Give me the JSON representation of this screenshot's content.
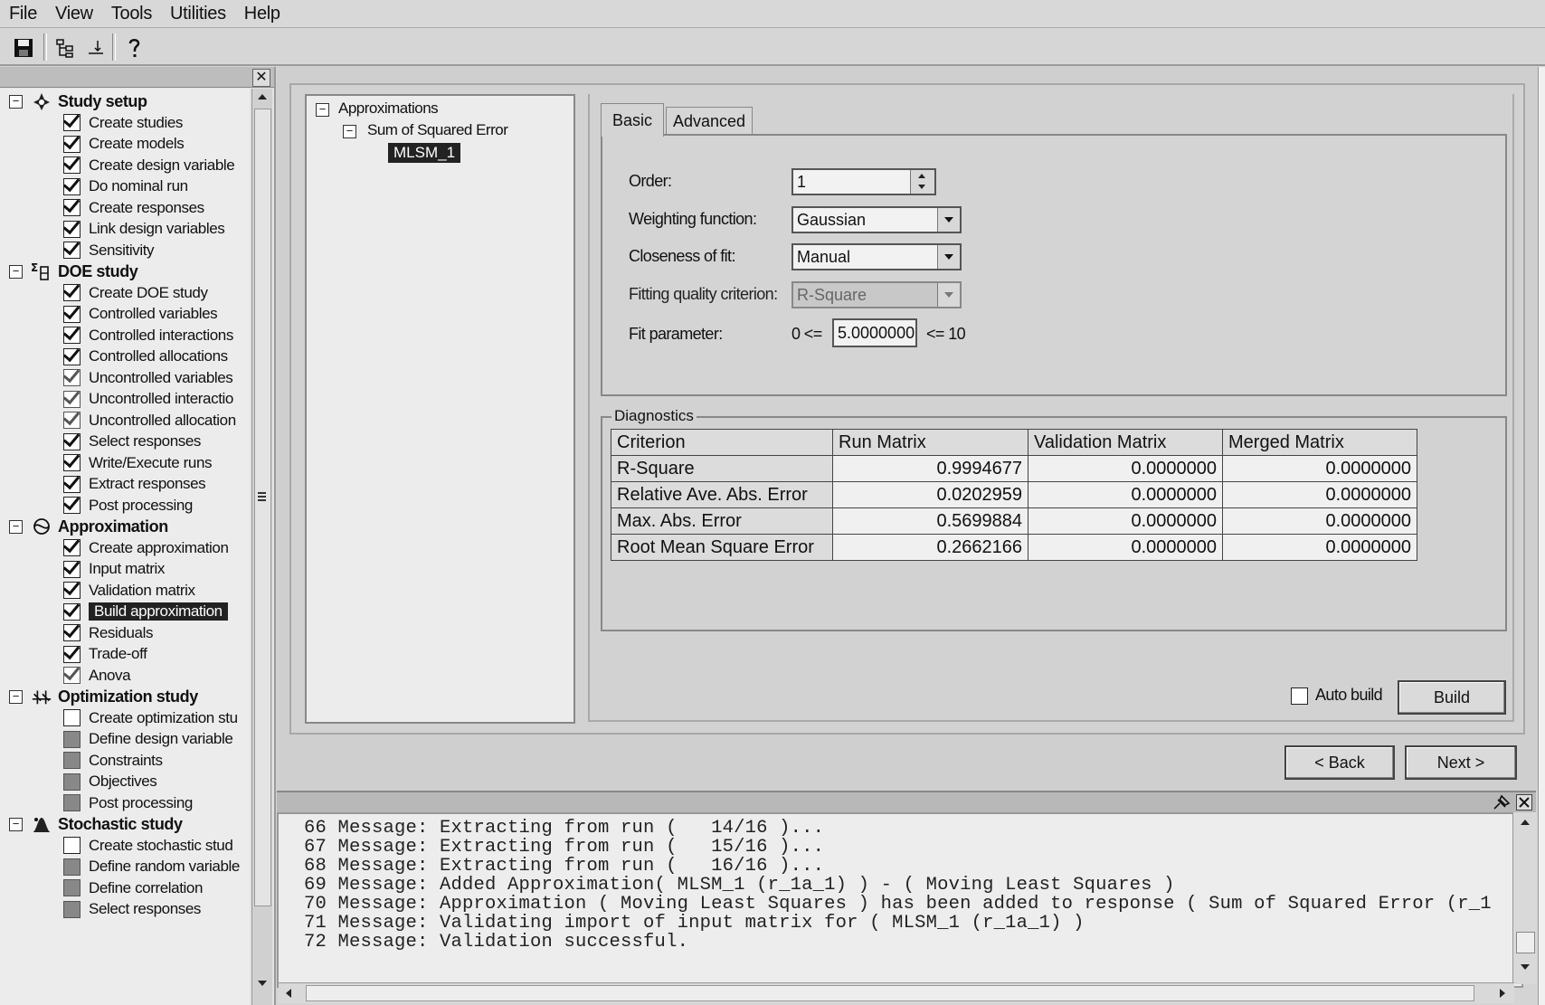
{
  "menu": [
    "File",
    "View",
    "Tools",
    "Utilities",
    "Help"
  ],
  "left_panel": {
    "close_glyph": "✕",
    "groups": [
      {
        "label": "Study setup",
        "icon": "study-setup-icon",
        "items": [
          {
            "label": "Create studies",
            "state": "checked"
          },
          {
            "label": "Create models",
            "state": "checked"
          },
          {
            "label": "Create design variable",
            "state": "checked"
          },
          {
            "label": "Do nominal run",
            "state": "checked"
          },
          {
            "label": "Create responses",
            "state": "checked"
          },
          {
            "label": "Link design variables",
            "state": "checked"
          },
          {
            "label": "Sensitivity",
            "state": "checked"
          }
        ]
      },
      {
        "label": "DOE study",
        "icon": "doe-icon",
        "items": [
          {
            "label": "Create DOE study",
            "state": "checked"
          },
          {
            "label": "Controlled variables",
            "state": "checked"
          },
          {
            "label": "Controlled interactions",
            "state": "checked"
          },
          {
            "label": "Controlled allocations",
            "state": "checked"
          },
          {
            "label": "Uncontrolled variables",
            "state": "partial"
          },
          {
            "label": "Uncontrolled interactio",
            "state": "partial"
          },
          {
            "label": "Uncontrolled allocation",
            "state": "partial"
          },
          {
            "label": "Select responses",
            "state": "checked"
          },
          {
            "label": "Write/Execute runs",
            "state": "checked"
          },
          {
            "label": "Extract responses",
            "state": "checked"
          },
          {
            "label": "Post processing",
            "state": "checked"
          }
        ]
      },
      {
        "label": "Approximation",
        "icon": "approximation-icon",
        "items": [
          {
            "label": "Create approximation",
            "state": "checked"
          },
          {
            "label": "Input matrix",
            "state": "checked"
          },
          {
            "label": "Validation matrix",
            "state": "checked"
          },
          {
            "label": "Build approximation",
            "state": "checked",
            "selected": true
          },
          {
            "label": "Residuals",
            "state": "checked"
          },
          {
            "label": "Trade-off",
            "state": "checked"
          },
          {
            "label": "Anova",
            "state": "partial"
          }
        ]
      },
      {
        "label": "Optimization study",
        "icon": "optimization-icon",
        "items": [
          {
            "label": "Create optimization stu",
            "state": "empty"
          },
          {
            "label": "Define design variable",
            "state": "disabled"
          },
          {
            "label": "Constraints",
            "state": "disabled"
          },
          {
            "label": "Objectives",
            "state": "disabled"
          },
          {
            "label": "Post processing",
            "state": "disabled"
          }
        ]
      },
      {
        "label": "Stochastic study",
        "icon": "stochastic-icon",
        "items": [
          {
            "label": "Create stochastic stud",
            "state": "empty"
          },
          {
            "label": "Define random variable",
            "state": "disabled"
          },
          {
            "label": "Define correlation",
            "state": "disabled"
          },
          {
            "label": "Select responses",
            "state": "disabled"
          }
        ]
      }
    ]
  },
  "approx_tree": {
    "root": "Approximations",
    "child": "Sum of Squared Error",
    "leaf": "MLSM_1"
  },
  "tabs": [
    "Basic",
    "Advanced"
  ],
  "form": {
    "order_label": "Order:",
    "order_value": "1",
    "weighting_label": "Weighting function:",
    "weighting_value": "Gaussian",
    "closeness_label": "Closeness of fit:",
    "closeness_value": "Manual",
    "quality_label": "Fitting quality criterion:",
    "quality_value": "R-Square",
    "fit_label": "Fit parameter:",
    "fit_min": "0 <=",
    "fit_value": "5.0000000",
    "fit_max": "<= 10"
  },
  "diagnostics": {
    "label": "Diagnostics",
    "columns": [
      "Criterion",
      "Run Matrix",
      "Validation Matrix",
      "Merged Matrix"
    ],
    "rows": [
      [
        "R-Square",
        "0.9994677",
        "0.0000000",
        "0.0000000"
      ],
      [
        "Relative Ave. Abs. Error",
        "0.0202959",
        "0.0000000",
        "0.0000000"
      ],
      [
        "Max. Abs. Error",
        "0.5699884",
        "0.0000000",
        "0.0000000"
      ],
      [
        "Root Mean Square Error",
        "0.2662166",
        "0.0000000",
        "0.0000000"
      ]
    ]
  },
  "buttons": {
    "auto_build": "Auto build",
    "build": "Build",
    "back": "< Back",
    "next": "Next >"
  },
  "log": [
    "66 Message: Extracting from run (   14/16 )...",
    "67 Message: Extracting from run (   15/16 )...",
    "68 Message: Extracting from run (   16/16 )...",
    "69 Message: Added Approximation( MLSM_1 (r_1a_1) ) - ( Moving Least Squares )",
    "70 Message: Approximation ( Moving Least Squares ) has been added to response ( Sum of Squared Error (r_1",
    "71 Message: Validating import of input matrix for ( MLSM_1 (r_1a_1) )",
    "72 Message: Validation successful."
  ]
}
